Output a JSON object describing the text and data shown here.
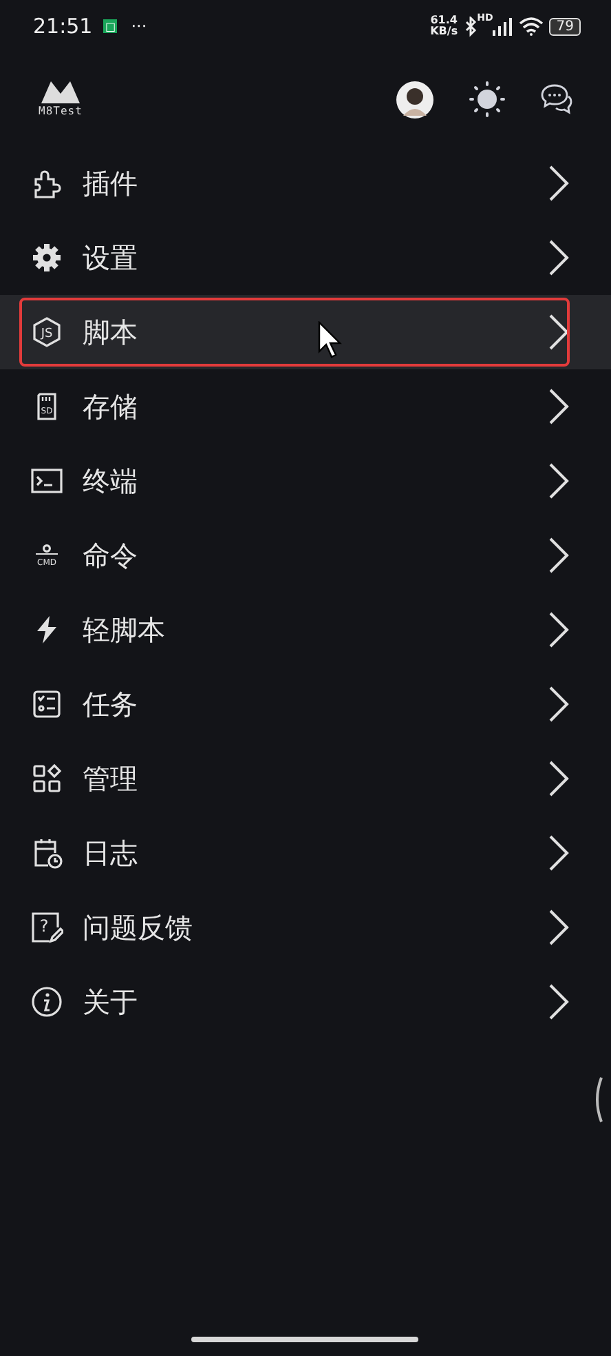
{
  "status_bar": {
    "time": "21:51",
    "notification_icon": "□",
    "more": "···",
    "net_speed": "61.4",
    "net_unit": "KB/s",
    "network_type": "HD",
    "battery": "79"
  },
  "header": {
    "logo_text": "M8Test"
  },
  "menu": [
    {
      "label": "插件",
      "selected": false
    },
    {
      "label": "设置",
      "selected": false
    },
    {
      "label": "脚本",
      "selected": true,
      "icon_text": "JS"
    },
    {
      "label": "存储",
      "selected": false,
      "icon_text": "SD"
    },
    {
      "label": "终端",
      "selected": false
    },
    {
      "label": "命令",
      "selected": false,
      "icon_text": "CMD"
    },
    {
      "label": "轻脚本",
      "selected": false
    },
    {
      "label": "任务",
      "selected": false
    },
    {
      "label": "管理",
      "selected": false
    },
    {
      "label": "日志",
      "selected": false
    },
    {
      "label": "问题反馈",
      "selected": false,
      "icon_text": "?"
    },
    {
      "label": "关于",
      "selected": false
    }
  ]
}
